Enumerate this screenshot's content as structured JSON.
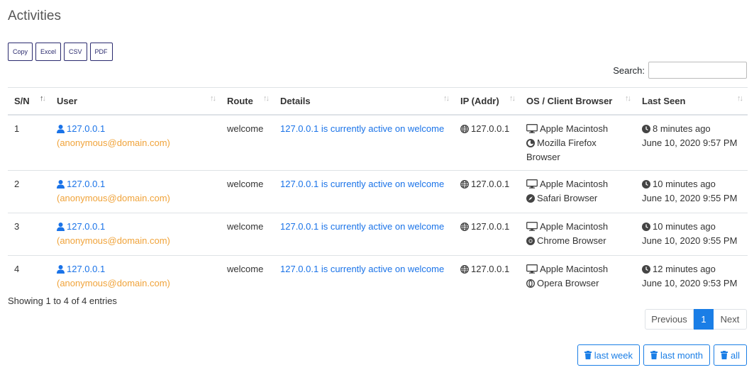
{
  "page": {
    "title": "Activities"
  },
  "export": {
    "copy": "Copy",
    "excel": "Excel",
    "csv": "CSV",
    "pdf": "PDF"
  },
  "search": {
    "label": "Search:",
    "value": "",
    "placeholder": ""
  },
  "table": {
    "headers": [
      "S/N",
      "User",
      "Route",
      "Details",
      "IP (Addr)",
      "OS / Client Browser",
      "Last Seen"
    ],
    "sort_column": "S/N",
    "rows": [
      {
        "sn": "1",
        "user_ip": "127.0.0.1",
        "user_email": "(anonymous@domain.com)",
        "route": "welcome",
        "details": "127.0.0.1 is currently active on welcome",
        "ip": "127.0.0.1",
        "os": "Apple Macintosh",
        "browser": "Mozilla Firefox Browser",
        "browser_icon": "firefox-icon",
        "ago": "8 minutes ago",
        "date": "June 10, 2020 9:57 PM"
      },
      {
        "sn": "2",
        "user_ip": "127.0.0.1",
        "user_email": "(anonymous@domain.com)",
        "route": "welcome",
        "details": "127.0.0.1 is currently active on welcome",
        "ip": "127.0.0.1",
        "os": "Apple Macintosh",
        "browser": "Safari Browser",
        "browser_icon": "safari-icon",
        "ago": "10 minutes ago",
        "date": "June 10, 2020 9:55 PM"
      },
      {
        "sn": "3",
        "user_ip": "127.0.0.1",
        "user_email": "(anonymous@domain.com)",
        "route": "welcome",
        "details": "127.0.0.1 is currently active on welcome",
        "ip": "127.0.0.1",
        "os": "Apple Macintosh",
        "browser": "Chrome Browser",
        "browser_icon": "chrome-icon",
        "ago": "10 minutes ago",
        "date": "June 10, 2020 9:55 PM"
      },
      {
        "sn": "4",
        "user_ip": "127.0.0.1",
        "user_email": "(anonymous@domain.com)",
        "route": "welcome",
        "details": "127.0.0.1 is currently active on welcome",
        "ip": "127.0.0.1",
        "os": "Apple Macintosh",
        "browser": "Opera Browser",
        "browser_icon": "opera-icon",
        "ago": "12 minutes ago",
        "date": "June 10, 2020 9:53 PM"
      }
    ]
  },
  "info": "Showing 1 to 4 of 4 entries",
  "pagination": {
    "previous": "Previous",
    "current": "1",
    "next": "Next"
  },
  "delete": {
    "last_week": "last week",
    "last_month": "last month",
    "all": "all"
  },
  "colors": {
    "link": "#1a73e8",
    "email": "#f0a33a",
    "primary": "#1a7ee6"
  }
}
